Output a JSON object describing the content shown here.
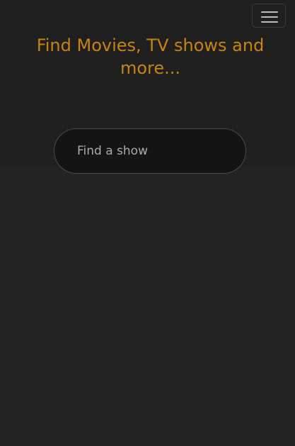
{
  "header": {
    "menu_icon": "hamburger-menu-icon"
  },
  "hero": {
    "headline": "Find Movies, TV shows and more..."
  },
  "search": {
    "value": "",
    "placeholder": "Find a show"
  },
  "colors": {
    "accent": "#c6850a",
    "background": "#232323",
    "hero_background": "#1f1f1f",
    "search_background": "#141414"
  }
}
